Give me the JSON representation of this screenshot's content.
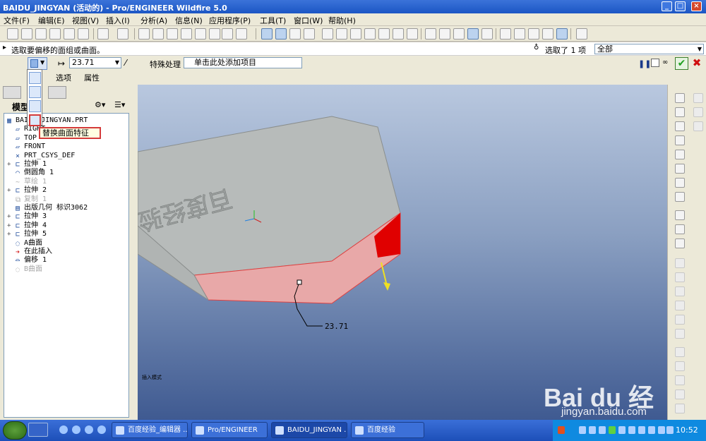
{
  "window": {
    "title": "BAIDU_JINGYAN (活动的) - Pro/ENGINEER Wildfire 5.0"
  },
  "menubar": {
    "items": [
      "文件(F)",
      "编辑(E)",
      "视图(V)",
      "插入(I)",
      "分析(A)",
      "信息(N)",
      "应用程序(P)",
      "工具(T)",
      "窗口(W)",
      "帮助(H)"
    ]
  },
  "message": {
    "prompt": "选取要偏移的面组或曲面。",
    "picked": "选取了 1 项",
    "filter": "全部"
  },
  "dashboard": {
    "offset_value": "23.71",
    "special_label": "特殊处理",
    "collector": "单击此处添加项目",
    "tab_options": "选项",
    "tab_properties": "属性"
  },
  "dropdown": {
    "tooltip": "替换曲面特征"
  },
  "model_tree": {
    "label": "模型",
    "items": [
      {
        "label": "BAIDU_JINGYAN.PRT",
        "icon": "part-icon",
        "expand": false,
        "disabled": false
      },
      {
        "label": "RIGHT",
        "icon": "datum-plane-icon",
        "expand": false,
        "disabled": false
      },
      {
        "label": "TOP",
        "icon": "datum-plane-icon",
        "expand": false,
        "disabled": false
      },
      {
        "label": "FRONT",
        "icon": "datum-plane-icon",
        "expand": false,
        "disabled": false
      },
      {
        "label": "PRT_CSYS_DEF",
        "icon": "csys-icon",
        "expand": false,
        "disabled": false
      },
      {
        "label": "拉伸 1",
        "icon": "extrude-icon",
        "expand": true,
        "disabled": false
      },
      {
        "label": "倒圆角 1",
        "icon": "round-icon",
        "expand": false,
        "disabled": false
      },
      {
        "label": "草绘 1",
        "icon": "sketch-icon",
        "expand": false,
        "disabled": true
      },
      {
        "label": "拉伸 2",
        "icon": "extrude-icon",
        "expand": true,
        "disabled": false
      },
      {
        "label": "复制 1",
        "icon": "copy-icon",
        "expand": false,
        "disabled": true
      },
      {
        "label": "出版几何 标识3062",
        "icon": "publish-geom-icon",
        "expand": false,
        "disabled": false
      },
      {
        "label": "拉伸 3",
        "icon": "extrude-icon",
        "expand": true,
        "disabled": false
      },
      {
        "label": "拉伸 4",
        "icon": "extrude-icon",
        "expand": true,
        "disabled": false
      },
      {
        "label": "拉伸 5",
        "icon": "extrude-icon",
        "expand": true,
        "disabled": false
      },
      {
        "label": "A曲面",
        "icon": "surface-icon",
        "expand": false,
        "disabled": false
      },
      {
        "label": "在此插入",
        "icon": "insert-here-icon",
        "expand": false,
        "disabled": false
      },
      {
        "label": "偏移 1",
        "icon": "offset-icon",
        "expand": false,
        "disabled": false
      },
      {
        "label": "B曲面",
        "icon": "surface-icon",
        "expand": false,
        "disabled": true
      }
    ]
  },
  "graphics": {
    "model_text": "百度经验",
    "dimension": "23.71",
    "mode_text": "插入模式",
    "colors": {
      "face_highlight": "#e8a8a8",
      "selected": "#e00000",
      "body": "#b7bbba"
    }
  },
  "watermark": {
    "brand": "Bai du 经验",
    "url": "jingyan.baidu.com"
  },
  "taskbar": {
    "tasks": [
      "百度经验_编辑器 ...",
      "Pro/ENGINEER",
      "BAIDU_JINGYAN ...",
      "百度经验"
    ],
    "clock": "10:52"
  }
}
